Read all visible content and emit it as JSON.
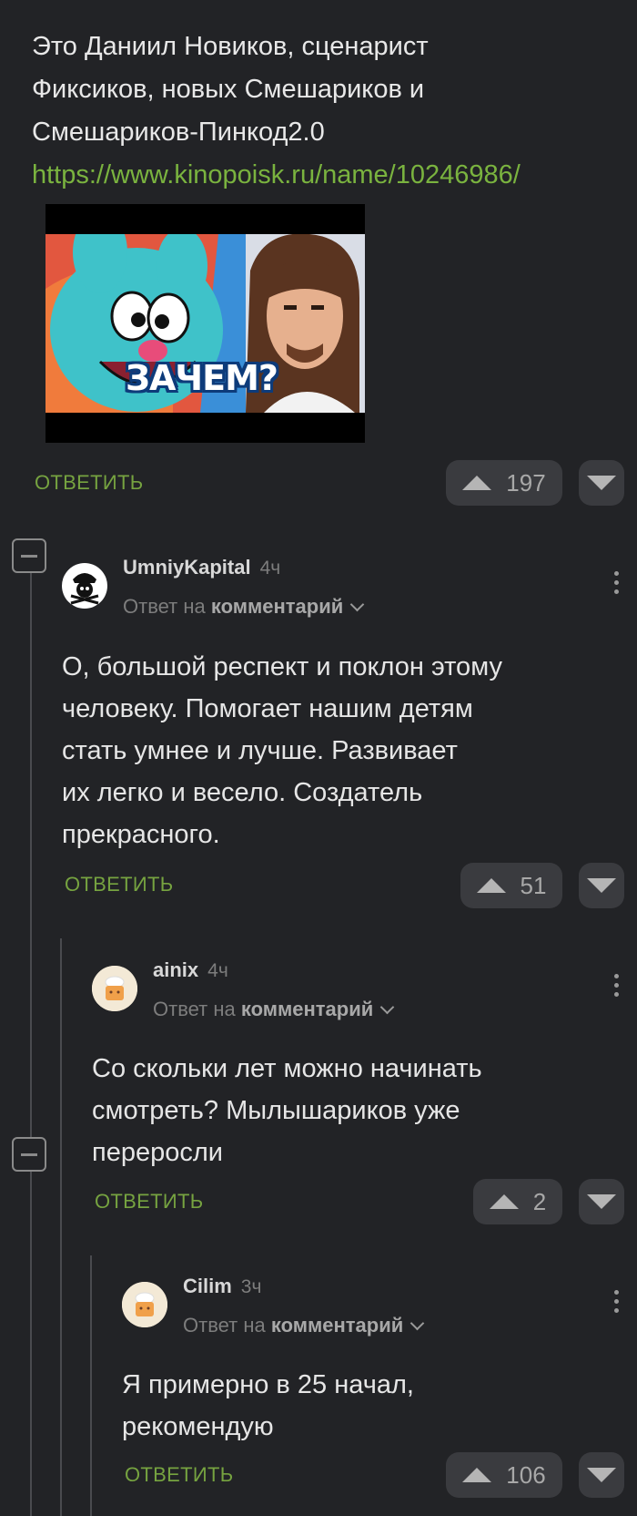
{
  "post": {
    "text_lines": [
      "Это Даниил Новиков, сценарист",
      "Фиксиков, новых Смешариков и",
      "Смешариков-Пинкод2.0"
    ],
    "link": "https://www.kinopoisk.ru/name/10246986/",
    "thumbnail_caption": "ЗАЧЕМ?",
    "reply_label": "ОТВЕТИТЬ",
    "score": "197"
  },
  "comments": [
    {
      "username": "UmniyKapital",
      "time": "4ч",
      "reply_prefix": "Ответ на",
      "reply_target": "комментарий",
      "text_lines": [
        "О, большой респект и поклон этому",
        "человеку. Помогает нашим детям",
        "стать умнее и лучше. Развивает",
        "их легко и весело. Создатель",
        "прекрасного."
      ],
      "reply_label": "ОТВЕТИТЬ",
      "score": "51"
    },
    {
      "username": "ainix",
      "time": "4ч",
      "reply_prefix": "Ответ на",
      "reply_target": "комментарий",
      "text_lines": [
        "Со скольки лет можно начинать",
        "смотреть? Мылышариков уже",
        "переросли"
      ],
      "reply_label": "ОТВЕТИТЬ",
      "score": "2"
    },
    {
      "username": "Cilim",
      "time": "3ч",
      "reply_prefix": "Ответ на",
      "reply_target": "комментарий",
      "text_lines": [
        "Я примерно в 25 начал,",
        "рекомендую"
      ],
      "reply_label": "ОТВЕТИТЬ",
      "score": "106"
    }
  ],
  "colors": {
    "background": "#222326",
    "accent_green": "#76a340",
    "link_green": "#7ab33f",
    "button_bg": "#3a3b3f"
  },
  "icons": [
    "upvote-icon",
    "downvote-icon",
    "collapse-icon",
    "more-options-icon",
    "chevron-down-icon"
  ]
}
